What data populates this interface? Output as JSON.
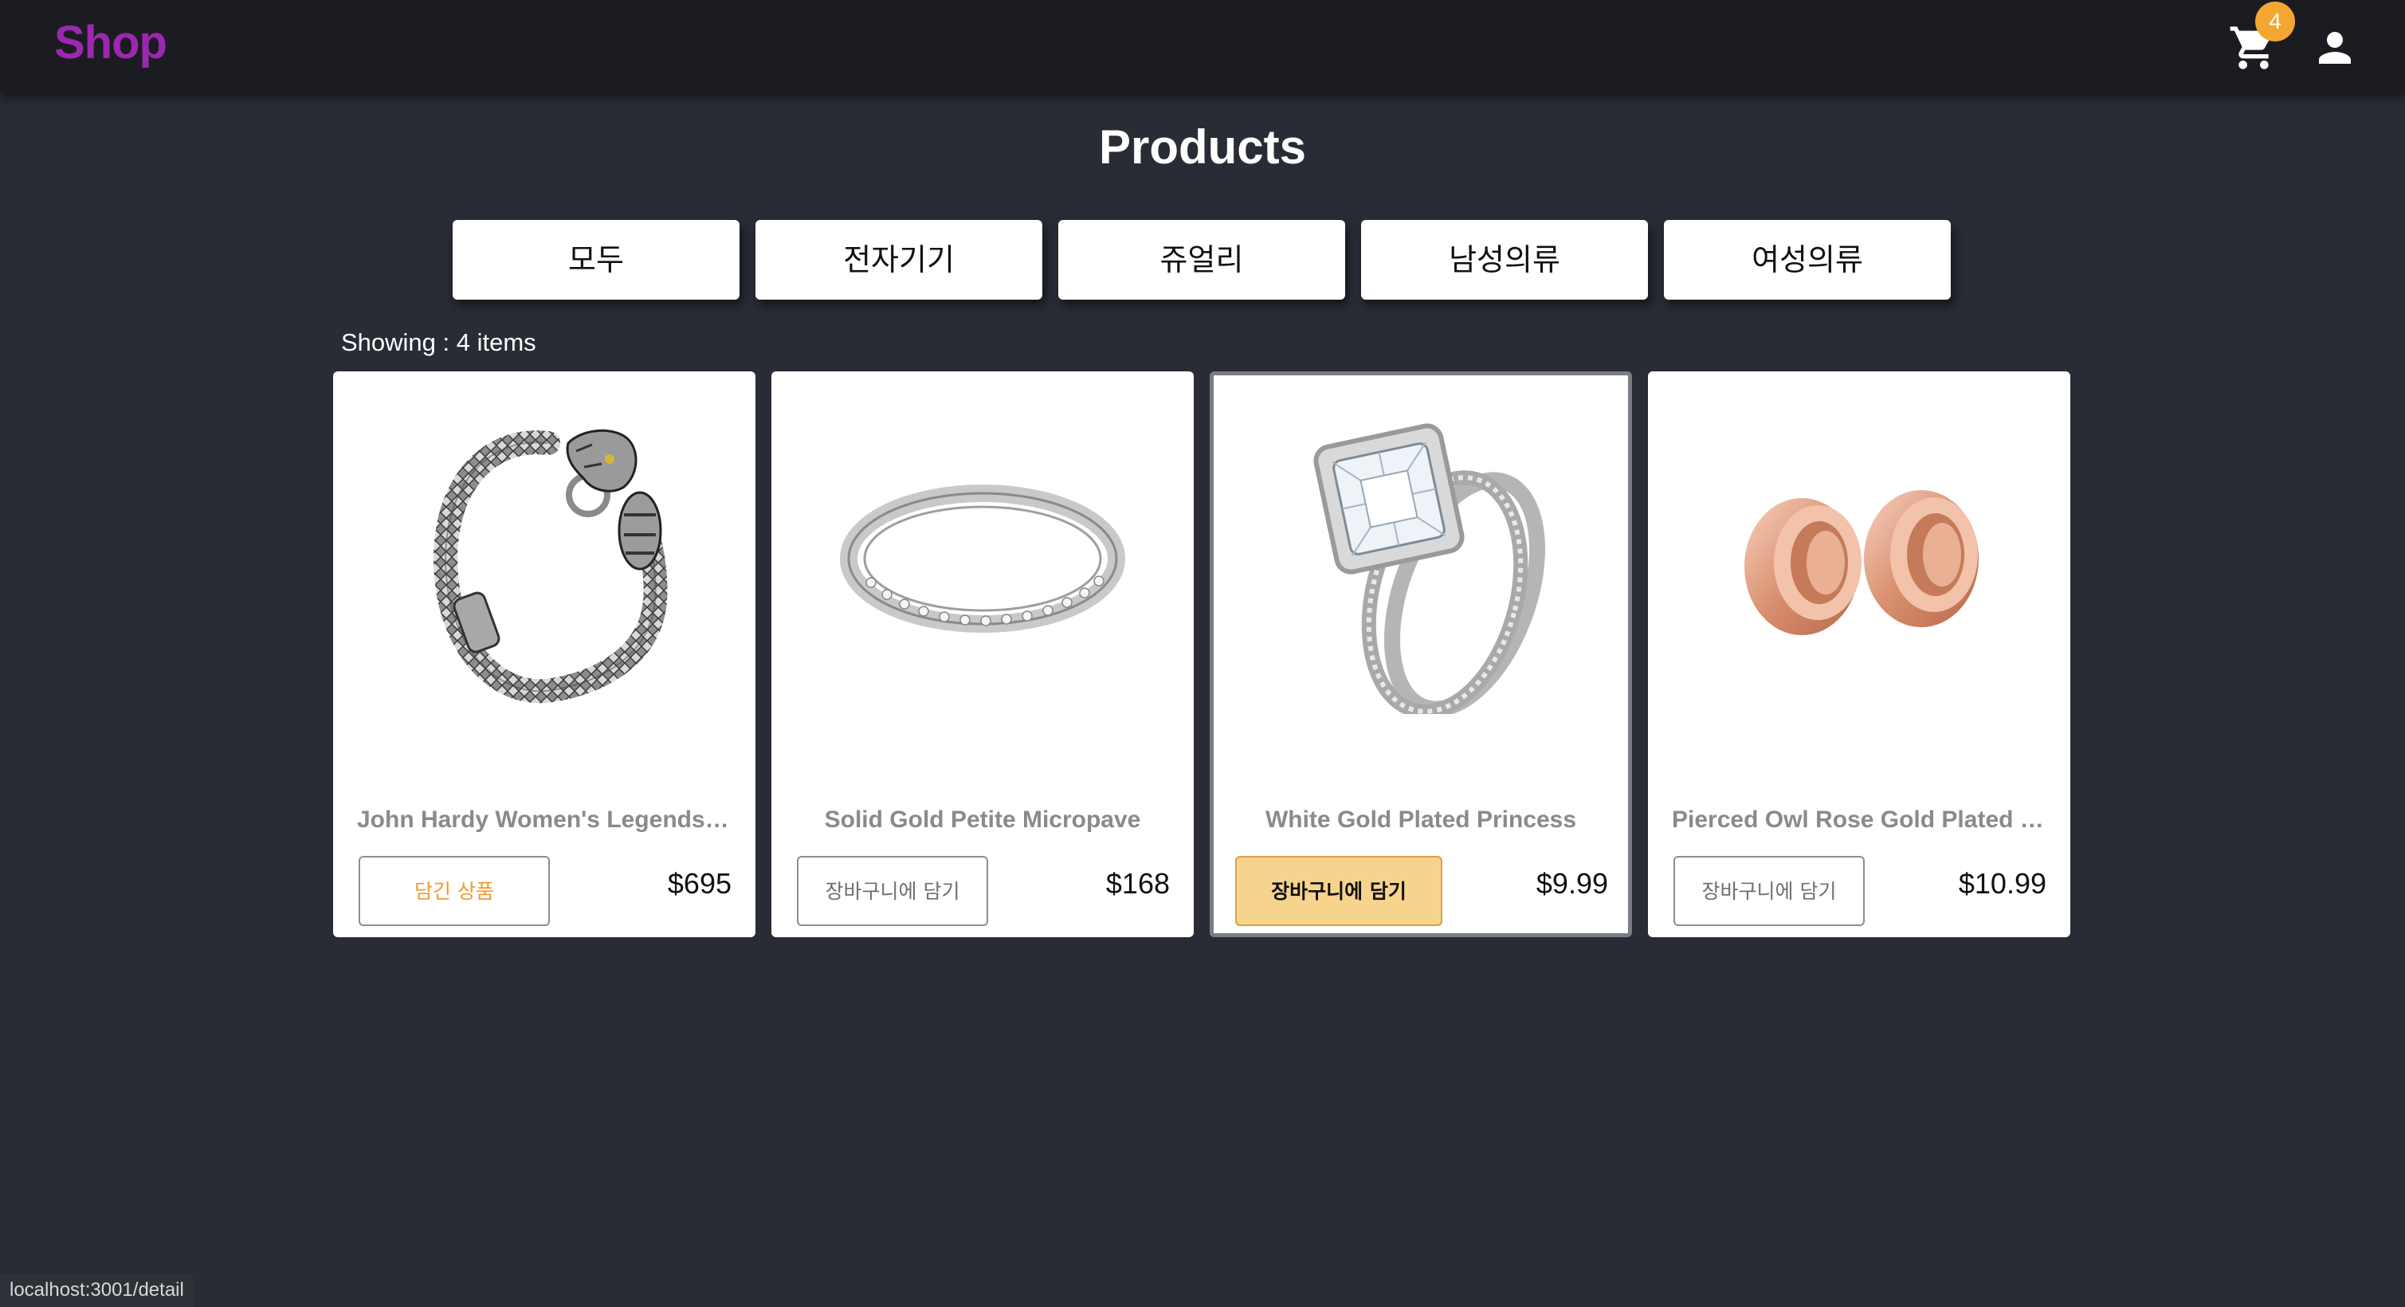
{
  "header": {
    "logo": "Shop",
    "cart_count": "4"
  },
  "page": {
    "title": "Products",
    "showing": "Showing : 4 items"
  },
  "categories": [
    "모두",
    "전자기기",
    "쥬얼리",
    "남성의류",
    "여성의류"
  ],
  "products": [
    {
      "title": "John Hardy Women's Legends Naga Gold & Silver Dragon Station Chain Bracelet",
      "button": "담긴 상품",
      "price": "$695"
    },
    {
      "title": "Solid Gold Petite Micropave",
      "button": "장바구니에 담기",
      "price": "$168"
    },
    {
      "title": "White Gold Plated Princess",
      "button": "장바구니에 담기",
      "price": "$9.99"
    },
    {
      "title": "Pierced Owl Rose Gold Plated Stainless Steel Double",
      "button": "장바구니에 담기",
      "price": "$10.99"
    }
  ],
  "status_bar": {
    "url": "localhost:3001/detail"
  },
  "colors": {
    "background": "#292c35",
    "header": "#1b1c21",
    "logo": "#9c27b0",
    "badge": "#f3a632",
    "in_cart_text": "#f29a2b",
    "highlight_button": "#f7d48e"
  }
}
